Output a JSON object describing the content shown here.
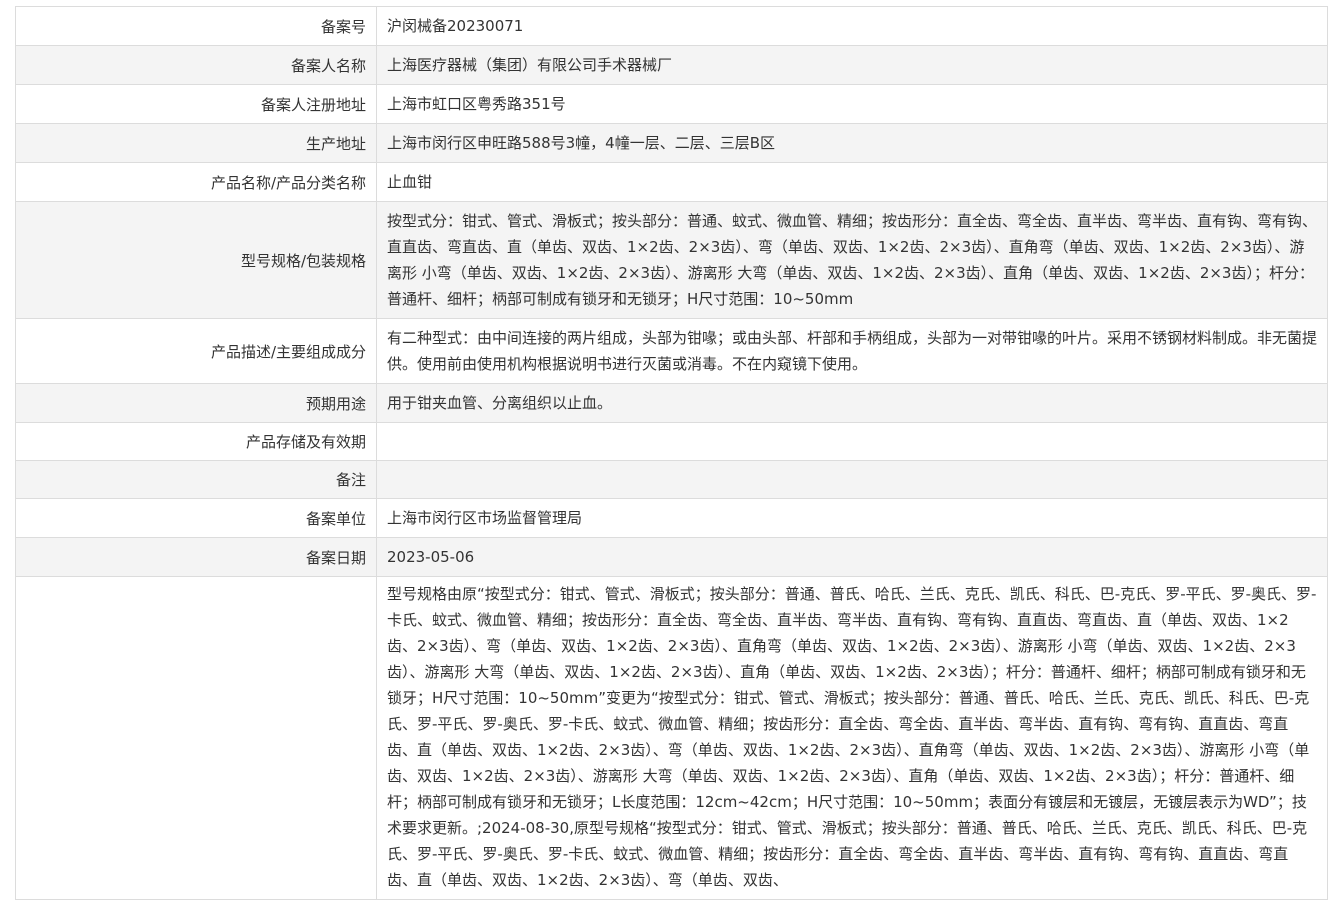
{
  "rows": [
    {
      "label": "备案号",
      "value": "沪闵械备20230071"
    },
    {
      "label": "备案人名称",
      "value": "上海医疗器械（集团）有限公司手术器械厂"
    },
    {
      "label": "备案人注册地址",
      "value": "上海市虹口区粤秀路351号"
    },
    {
      "label": "生产地址",
      "value": "上海市闵行区申旺路588号3幢，4幢一层、二层、三层B区"
    },
    {
      "label": "产品名称/产品分类名称",
      "value": "止血钳"
    },
    {
      "label": "型号规格/包装规格",
      "value": "按型式分：钳式、管式、滑板式；按头部分：普通、蚊式、微血管、精细；按齿形分：直全齿、弯全齿、直半齿、弯半齿、直有钩、弯有钩、直直齿、弯直齿、直（单齿、双齿、1×2齿、2×3齿）、弯（单齿、双齿、1×2齿、2×3齿）、直角弯（单齿、双齿、1×2齿、2×3齿）、游离形 小弯（单齿、双齿、1×2齿、2×3齿）、游离形 大弯（单齿、双齿、1×2齿、2×3齿）、直角（单齿、双齿、1×2齿、2×3齿）；杆分：普通杆、细杆；柄部可制成有锁牙和无锁牙；H尺寸范围：10~50mm"
    },
    {
      "label": "产品描述/主要组成成分",
      "value": "有二种型式：由中间连接的两片组成，头部为钳喙；或由头部、杆部和手柄组成，头部为一对带钳喙的叶片。采用不锈钢材料制成。非无菌提供。使用前由使用机构根据说明书进行灭菌或消毒。不在内窥镜下使用。"
    },
    {
      "label": "预期用途",
      "value": "用于钳夹血管、分离组织以止血。"
    },
    {
      "label": "产品存储及有效期",
      "value": ""
    },
    {
      "label": "备注",
      "value": ""
    },
    {
      "label": "备案单位",
      "value": "上海市闵行区市场监督管理局"
    },
    {
      "label": "备案日期",
      "value": "2023-05-06"
    },
    {
      "label": "",
      "value": "型号规格由原“按型式分：钳式、管式、滑板式；按头部分：普通、普氏、哈氏、兰氏、克氏、凯氏、科氏、巴-克氏、罗-平氏、罗-奥氏、罗-卡氏、蚊式、微血管、精细；按齿形分：直全齿、弯全齿、直半齿、弯半齿、直有钩、弯有钩、直直齿、弯直齿、直（单齿、双齿、1×2齿、2×3齿）、弯（单齿、双齿、1×2齿、2×3齿）、直角弯（单齿、双齿、1×2齿、2×3齿）、游离形 小弯（单齿、双齿、1×2齿、2×3齿）、游离形 大弯（单齿、双齿、1×2齿、2×3齿）、直角（单齿、双齿、1×2齿、2×3齿）；杆分：普通杆、细杆；柄部可制成有锁牙和无锁牙；H尺寸范围：10~50mm”变更为“按型式分：钳式、管式、滑板式；按头部分：普通、普氏、哈氏、兰氏、克氏、凯氏、科氏、巴-克氏、罗-平氏、罗-奥氏、罗-卡氏、蚊式、微血管、精细；按齿形分：直全齿、弯全齿、直半齿、弯半齿、直有钩、弯有钩、直直齿、弯直齿、直（单齿、双齿、1×2齿、2×3齿）、弯（单齿、双齿、1×2齿、2×3齿）、直角弯（单齿、双齿、1×2齿、2×3齿）、游离形 小弯（单齿、双齿、1×2齿、2×3齿）、游离形 大弯（单齿、双齿、1×2齿、2×3齿）、直角（单齿、双齿、1×2齿、2×3齿）；杆分：普通杆、细杆；柄部可制成有锁牙和无锁牙；L长度范围：12cm~42cm；H尺寸范围：10~50mm；表面分有镀层和无镀层，无镀层表示为WD”；技术要求更新。;2024-08-30,原型号规格“按型式分：钳式、管式、滑板式；按头部分：普通、普氏、哈氏、兰氏、克氏、凯氏、科氏、巴-克氏、罗-平氏、罗-奥氏、罗-卡氏、蚊式、微血管、精细；按齿形分：直全齿、弯全齿、直半齿、弯半齿、直有钩、弯有钩、直直齿、弯直齿、直（单齿、双齿、1×2齿、2×3齿）、弯（单齿、双齿、"
    }
  ]
}
